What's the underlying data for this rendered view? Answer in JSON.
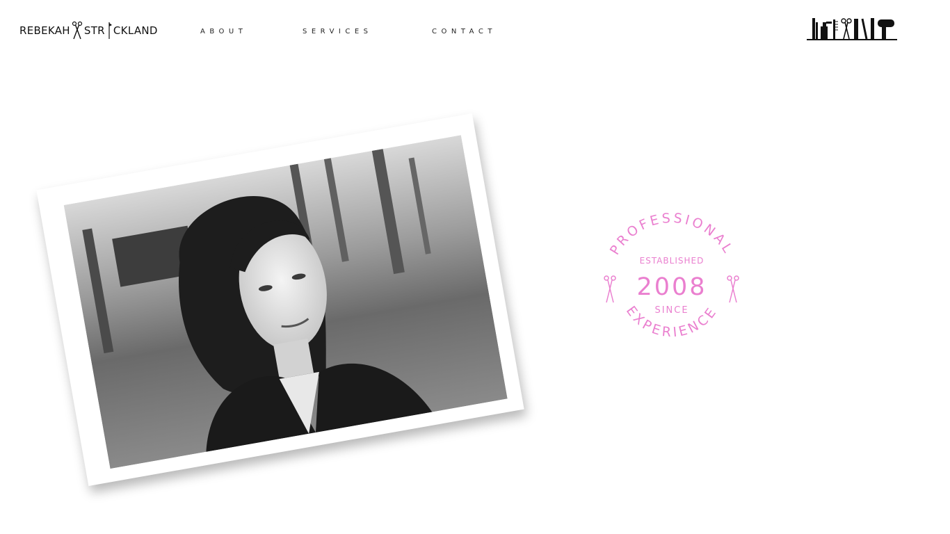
{
  "header": {
    "logo_first": "REBEKAH",
    "logo_last": "STR",
    "logo_tail": "CKLAND",
    "nav": [
      {
        "label": "ABOUT"
      },
      {
        "label": "SERVICES"
      },
      {
        "label": "CONTACT"
      }
    ]
  },
  "hero": {
    "badge": {
      "top_arc": "PROFESSIONAL",
      "bottom_arc": "EXPERIENCE",
      "established": "ESTABLISHED",
      "year": "2008",
      "since": "SINCE",
      "color": "#ea7fcf"
    }
  },
  "icons": {
    "logo_scissors": "scissors-icon",
    "tools_banner": "salon-tools-icon",
    "badge_left": "scissors-icon",
    "badge_right": "scissors-icon"
  }
}
